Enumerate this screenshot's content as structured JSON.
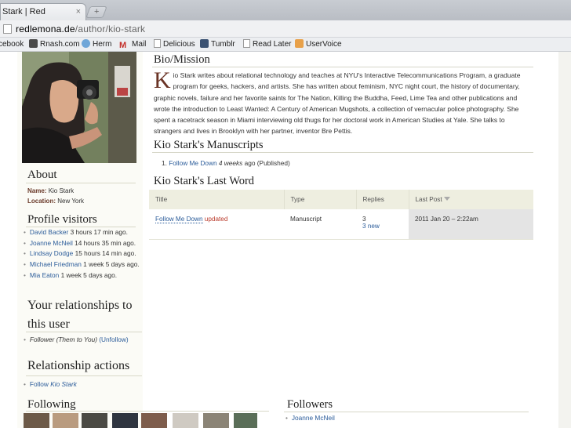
{
  "browser": {
    "tab_title": "Stark | Red lemonade",
    "tab_close": "×",
    "new_tab": "+",
    "url_host": "redlemona.de",
    "url_path": "/author/kio-stark",
    "bookmarks": [
      "cebook",
      "Rnash.com",
      "Herm",
      "Mail",
      "Delicious",
      "Tumblr",
      "Read Later",
      "UserVoice"
    ]
  },
  "sidebar": {
    "about_heading": "About",
    "name_label": "Name:",
    "name_value": "Kio Stark",
    "location_label": "Location:",
    "location_value": "New York",
    "visitors_heading": "Profile visitors",
    "visitors": [
      {
        "name": "David Backer",
        "time": "3 hours 17 min ago."
      },
      {
        "name": "Joanne McNeil",
        "time": "14 hours 35 min ago."
      },
      {
        "name": "Lindsay Dodge",
        "time": "15 hours 14 min ago."
      },
      {
        "name": "Michael Friedman",
        "time": "1 week 5 days ago."
      },
      {
        "name": "Mia Eaton",
        "time": "1 week 5 days ago."
      }
    ],
    "relationships_heading_1": "Your relationships to",
    "relationships_heading_2": "this user",
    "relationship_item": "Follower (Them to You)",
    "unfollow": "(Unfollow)",
    "actions_heading": "Relationship actions",
    "follow_prefix": "Follow",
    "follow_name": "Kio Stark",
    "following_heading": "Following"
  },
  "main": {
    "bio_heading": "Bio/Mission",
    "bio_dropcap": "K",
    "bio_text": "io Stark writes about relational technology and teaches at NYU's Interactive Telecommunications Program, a graduate program for geeks, hackers, and artists. She has written about feminism, NYC night court, the history of documentary, graphic novels, failure and her favorite saints for The Nation, Killing the Buddha, Feed, Lime Tea and other publications and wrote the introduction to Least Wanted: A Century of American Mugshots, a collection of vernacular police photography. She spent a racetrack season in Miami interviewing old thugs for her doctoral work in American Studies at Yale. She talks to strangers and lives in Brooklyn with her partner, inventor Bre Pettis.",
    "manuscripts_heading": "Kio Stark's Manuscripts",
    "manuscript": {
      "number": "1.",
      "title": "Follow Me Down",
      "age": "4 weeks",
      "suffix": "ago (Published)"
    },
    "lastword_heading": "Kio Stark's Last Word",
    "table": {
      "headers": [
        "Title",
        "Type",
        "Replies",
        "Last Post"
      ],
      "row": {
        "title": "Follow Me Down",
        "updated": "updated",
        "type": "Manuscript",
        "replies": "3",
        "new": "3 new",
        "last_post": "2011 Jan 20 – 2:22am"
      }
    },
    "followers_heading": "Followers",
    "followers": [
      "Joanne McNeil"
    ]
  }
}
